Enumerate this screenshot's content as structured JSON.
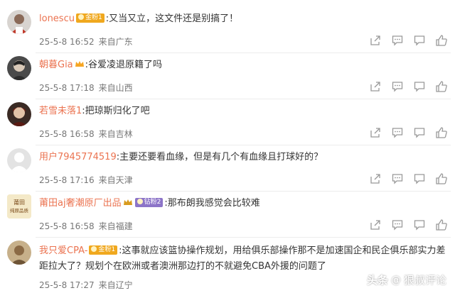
{
  "comments": [
    {
      "username": "lonescu",
      "badge": "金粉1",
      "badge_color": "#f0a81e",
      "text": ":又当又立，这文件还是别搞了！",
      "date": "25-5-8 16:52",
      "source": "来自广东"
    },
    {
      "username": "朝暮Gia",
      "vip": true,
      "text": ":谷爱凌退原籍了吗",
      "date": "25-5-8 17:18",
      "source": "来自山西"
    },
    {
      "username": "若雪未落1",
      "text": ":把琼斯归化了吧",
      "date": "25-5-8 16:58",
      "source": "来自吉林"
    },
    {
      "username": "用户7945774519",
      "text": ":主要还要看血缘，但是有几个有血缘且打球好的？",
      "date": "25-5-8 17:16",
      "source": "来自天津"
    },
    {
      "username": "莆田aj奢潮原厂出品",
      "badge": "钻粉2",
      "badge_color": "#8c74c8",
      "crown": true,
      "text": ":那布朗我感觉会比较难",
      "date": "25-5-8 16:58",
      "source": "来自福建"
    },
    {
      "username": "我只爱CPA-",
      "badge": "金粉1",
      "badge_color": "#f0a81e",
      "text": ":这事就应该篮协操作规划，用给俱乐部操作那不是加速国企和民企俱乐部实力差距拉大了？规划个在欧洲或者澳洲那边打的不就避免CBA外援的问题了",
      "date": "25-5-8 17:27",
      "source": "来自辽宁"
    }
  ],
  "avatar5_text": [
    "莆田",
    "纯原品质"
  ],
  "actions": [
    "share-icon",
    "comment-icon",
    "repost-icon",
    "like-icon"
  ],
  "watermark": {
    "brand": "头条",
    "at": "@",
    "name": "狠叔评论"
  },
  "accent_color": "#eb7350"
}
